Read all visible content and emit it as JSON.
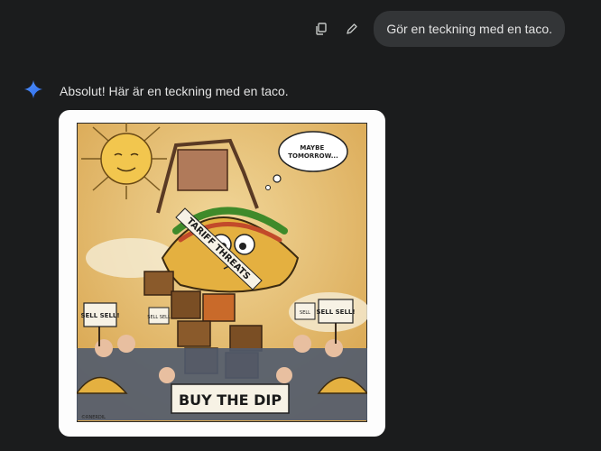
{
  "user_message": {
    "text": "Gör en teckning med en taco."
  },
  "icons": {
    "copy": "copy-icon",
    "edit": "edit-pencil-icon",
    "assistant": "gemini-sparkle-icon"
  },
  "response": {
    "text": "Absolut! Här är en teckning med en taco."
  },
  "image": {
    "speech_bubble": "MAYBE TOMORROW...",
    "sash_text": "TARIFF THREATS",
    "sign_left": "SELL SELL!",
    "sign_left_small": "SELL SELL",
    "sign_right": "SELL SELL!",
    "sign_right_small": "SELL",
    "banner": "BUY THE DIP",
    "signature": "©RNERDIL"
  },
  "colors": {
    "background": "#1b1c1d",
    "bubble": "#333537",
    "text": "#e3e3e3"
  }
}
